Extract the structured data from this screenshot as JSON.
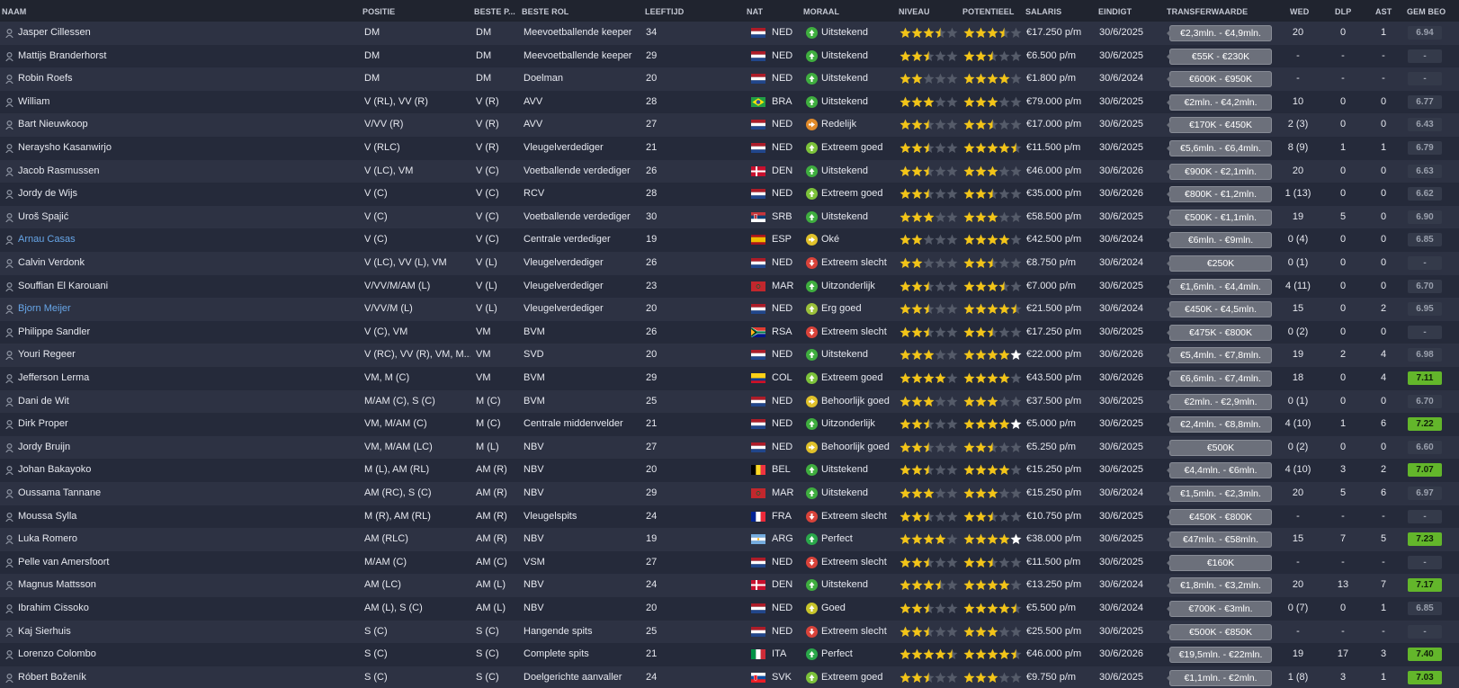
{
  "columns": {
    "naam": "NAAM",
    "positie": "POSITIE",
    "beste_p": "BESTE P...",
    "beste_rol": "BESTE ROL",
    "leeftijd": "LEEFTIJD",
    "nat": "NAT",
    "moraal": "MORAAL",
    "niveau": "NIVEAU",
    "potentieel": "POTENTIEEL",
    "salaris": "SALARIS",
    "eindigt": "EINDIGT",
    "transferwaarde": "TRANSFERWAARDE",
    "wed": "WED",
    "dlp": "DLP",
    "ast": "AST",
    "gem_beo": "GEM BEO"
  },
  "colors": {
    "header_bg": "#20242f",
    "row_odd": "#2d3243",
    "row_even": "#252a3a",
    "link": "#67a6e8",
    "star": "#f2c418",
    "rating_green": "#63b62b"
  },
  "players": [
    {
      "name": "Jasper Cillessen",
      "link": false,
      "pos": "DM",
      "best_pos": "DM",
      "role": "Meevoetballende keeper",
      "age": "34",
      "flag": "ned",
      "nat": "NED",
      "morale": "Uitstekend",
      "mor_type": "up",
      "mor_color": "#3fae3f",
      "niveau": 3.5,
      "potentieel": 3.5,
      "pot_white": false,
      "salary": "€17.250 p/m",
      "ends": "30/6/2025",
      "value": "€2,3mln. - €4,9mln.",
      "wed": "20",
      "dlp": "0",
      "ast": "1",
      "rating": "6.94",
      "rating_green": false
    },
    {
      "name": "Mattijs Branderhorst",
      "link": false,
      "pos": "DM",
      "best_pos": "DM",
      "role": "Meevoetballende keeper",
      "age": "29",
      "flag": "ned",
      "nat": "NED",
      "morale": "Uitstekend",
      "mor_type": "up",
      "mor_color": "#3fae3f",
      "niveau": 2.5,
      "potentieel": 2.5,
      "pot_white": false,
      "salary": "€6.500 p/m",
      "ends": "30/6/2025",
      "value": "€55K - €230K",
      "wed": "-",
      "dlp": "-",
      "ast": "-",
      "rating": "-",
      "rating_green": false
    },
    {
      "name": "Robin Roefs",
      "link": false,
      "pos": "DM",
      "best_pos": "DM",
      "role": "Doelman",
      "age": "20",
      "flag": "ned",
      "nat": "NED",
      "morale": "Uitstekend",
      "mor_type": "up",
      "mor_color": "#3fae3f",
      "niveau": 2,
      "potentieel": 4,
      "pot_white": true,
      "salary": "€1.800 p/m",
      "ends": "30/6/2024",
      "value": "€600K - €950K",
      "wed": "-",
      "dlp": "-",
      "ast": "-",
      "rating": "-",
      "rating_green": false
    },
    {
      "name": "William",
      "link": false,
      "pos": "V (RL), VV (R)",
      "best_pos": "V (R)",
      "role": "AVV",
      "age": "28",
      "flag": "bra",
      "nat": "BRA",
      "morale": "Uitstekend",
      "mor_type": "up",
      "mor_color": "#3fae3f",
      "niveau": 3,
      "potentieel": 3,
      "pot_white": false,
      "salary": "€79.000 p/m",
      "ends": "30/6/2025",
      "value": "€2mln. - €4,2mln.",
      "wed": "10",
      "dlp": "0",
      "ast": "0",
      "rating": "6.77",
      "rating_green": false
    },
    {
      "name": "Bart Nieuwkoop",
      "link": false,
      "pos": "V/VV (R)",
      "best_pos": "V (R)",
      "role": "AVV",
      "age": "27",
      "flag": "ned",
      "nat": "NED",
      "morale": "Redelijk",
      "mor_type": "right",
      "mor_color": "#e08a2a",
      "niveau": 2.5,
      "potentieel": 2.5,
      "pot_white": false,
      "salary": "€17.000 p/m",
      "ends": "30/6/2025",
      "value": "€170K - €450K",
      "wed": "2 (3)",
      "dlp": "0",
      "ast": "0",
      "rating": "6.43",
      "rating_green": false
    },
    {
      "name": "Neraysho Kasanwirjo",
      "link": false,
      "pos": "V (RLC)",
      "best_pos": "V (R)",
      "role": "Vleugelverdediger",
      "age": "21",
      "flag": "ned",
      "nat": "NED",
      "morale": "Extreem goed",
      "mor_type": "up",
      "mor_color": "#7cc23a",
      "niveau": 2.5,
      "potentieel": 4.5,
      "pot_white": false,
      "salary": "€11.500 p/m",
      "ends": "30/6/2025",
      "value": "€5,6mln. - €6,4mln.",
      "wed": "8 (9)",
      "dlp": "1",
      "ast": "1",
      "rating": "6.79",
      "rating_green": false
    },
    {
      "name": "Jacob Rasmussen",
      "link": false,
      "pos": "V (LC), VM",
      "best_pos": "V (C)",
      "role": "Voetballende verdediger",
      "age": "26",
      "flag": "den",
      "nat": "DEN",
      "morale": "Uitstekend",
      "mor_type": "up",
      "mor_color": "#3fae3f",
      "niveau": 2.5,
      "potentieel": 3,
      "pot_white": false,
      "salary": "€46.000 p/m",
      "ends": "30/6/2026",
      "value": "€900K - €2,1mln.",
      "wed": "20",
      "dlp": "0",
      "ast": "0",
      "rating": "6.63",
      "rating_green": false
    },
    {
      "name": "Jordy de Wijs",
      "link": false,
      "pos": "V (C)",
      "best_pos": "V (C)",
      "role": "RCV",
      "age": "28",
      "flag": "ned",
      "nat": "NED",
      "morale": "Extreem goed",
      "mor_type": "up",
      "mor_color": "#7cc23a",
      "niveau": 2.5,
      "potentieel": 2.5,
      "pot_white": false,
      "salary": "€35.000 p/m",
      "ends": "30/6/2026",
      "value": "€800K - €1,2mln.",
      "wed": "1 (13)",
      "dlp": "0",
      "ast": "0",
      "rating": "6.62",
      "rating_green": false
    },
    {
      "name": "Uroš Spajić",
      "link": false,
      "pos": "V (C)",
      "best_pos": "V (C)",
      "role": "Voetballende verdediger",
      "age": "30",
      "flag": "srb",
      "nat": "SRB",
      "morale": "Uitstekend",
      "mor_type": "up",
      "mor_color": "#3fae3f",
      "niveau": 3,
      "potentieel": 3,
      "pot_white": false,
      "salary": "€58.500 p/m",
      "ends": "30/6/2025",
      "value": "€500K - €1,1mln.",
      "wed": "19",
      "dlp": "5",
      "ast": "0",
      "rating": "6.90",
      "rating_green": false
    },
    {
      "name": "Arnau Casas",
      "link": true,
      "pos": "V (C)",
      "best_pos": "V (C)",
      "role": "Centrale verdediger",
      "age": "19",
      "flag": "esp",
      "nat": "ESP",
      "morale": "Oké",
      "mor_type": "right",
      "mor_color": "#e0c12a",
      "niveau": 2,
      "potentieel": 4,
      "pot_white": true,
      "salary": "€42.500 p/m",
      "ends": "30/6/2024",
      "value": "€6mln. - €9mln.",
      "wed": "0 (4)",
      "dlp": "0",
      "ast": "0",
      "rating": "6.85",
      "rating_green": false
    },
    {
      "name": "Calvin Verdonk",
      "link": false,
      "pos": "V (LC), VV (L), VM",
      "best_pos": "V (L)",
      "role": "Vleugelverdediger",
      "age": "26",
      "flag": "ned",
      "nat": "NED",
      "morale": "Extreem slecht",
      "mor_type": "down",
      "mor_color": "#d9433a",
      "niveau": 2,
      "potentieel": 2.5,
      "pot_white": false,
      "salary": "€8.750 p/m",
      "ends": "30/6/2024",
      "value": "€250K",
      "wed": "0 (1)",
      "dlp": "0",
      "ast": "0",
      "rating": "-",
      "rating_green": false
    },
    {
      "name": "Souffian El Karouani",
      "link": false,
      "pos": "V/VV/M/AM (L)",
      "best_pos": "V (L)",
      "role": "Vleugelverdediger",
      "age": "23",
      "flag": "mar",
      "nat": "MAR",
      "morale": "Uitzonderlijk",
      "mor_type": "up",
      "mor_color": "#3fae3f",
      "niveau": 2.5,
      "potentieel": 3.5,
      "pot_white": false,
      "salary": "€7.000 p/m",
      "ends": "30/6/2025",
      "value": "€1,6mln. - €4,4mln.",
      "wed": "4 (11)",
      "dlp": "0",
      "ast": "0",
      "rating": "6.70",
      "rating_green": false
    },
    {
      "name": "Bjorn Meijer",
      "link": true,
      "pos": "V/VV/M (L)",
      "best_pos": "V (L)",
      "role": "Vleugelverdediger",
      "age": "20",
      "flag": "ned",
      "nat": "NED",
      "morale": "Erg goed",
      "mor_type": "up",
      "mor_color": "#9bc13a",
      "niveau": 2.5,
      "potentieel": 4.5,
      "pot_white": false,
      "salary": "€21.500 p/m",
      "ends": "30/6/2024",
      "value": "€450K - €4,5mln.",
      "wed": "15",
      "dlp": "0",
      "ast": "2",
      "rating": "6.95",
      "rating_green": false
    },
    {
      "name": "Philippe Sandler",
      "link": false,
      "pos": "V (C), VM",
      "best_pos": "VM",
      "role": "BVM",
      "age": "26",
      "flag": "rsa",
      "nat": "RSA",
      "morale": "Extreem slecht",
      "mor_type": "down",
      "mor_color": "#d9433a",
      "niveau": 2.5,
      "potentieel": 2.5,
      "pot_white": false,
      "salary": "€17.250 p/m",
      "ends": "30/6/2025",
      "value": "€475K - €800K",
      "wed": "0 (2)",
      "dlp": "0",
      "ast": "0",
      "rating": "-",
      "rating_green": false
    },
    {
      "name": "Youri Regeer",
      "link": false,
      "pos": "V (RC), VV (R), VM, M...",
      "best_pos": "VM",
      "role": "SVD",
      "age": "20",
      "flag": "ned",
      "nat": "NED",
      "morale": "Uitstekend",
      "mor_type": "up",
      "mor_color": "#3fae3f",
      "niveau": 3,
      "potentieel": 5,
      "pot_white": true,
      "salary": "€22.000 p/m",
      "ends": "30/6/2026",
      "value": "€5,4mln. - €7,8mln.",
      "wed": "19",
      "dlp": "2",
      "ast": "4",
      "rating": "6.98",
      "rating_green": false
    },
    {
      "name": "Jefferson Lerma",
      "link": false,
      "pos": "VM, M (C)",
      "best_pos": "VM",
      "role": "BVM",
      "age": "29",
      "flag": "col",
      "nat": "COL",
      "morale": "Extreem goed",
      "mor_type": "up",
      "mor_color": "#7cc23a",
      "niveau": 4,
      "potentieel": 4,
      "pot_white": false,
      "salary": "€43.500 p/m",
      "ends": "30/6/2026",
      "value": "€6,6mln. - €7,4mln.",
      "wed": "18",
      "dlp": "0",
      "ast": "4",
      "rating": "7.11",
      "rating_green": true
    },
    {
      "name": "Dani de Wit",
      "link": false,
      "pos": "M/AM (C), S (C)",
      "best_pos": "M (C)",
      "role": "BVM",
      "age": "25",
      "flag": "ned",
      "nat": "NED",
      "morale": "Behoorlijk goed",
      "mor_type": "right",
      "mor_color": "#e0c12a",
      "niveau": 3,
      "potentieel": 3,
      "pot_white": false,
      "salary": "€37.500 p/m",
      "ends": "30/6/2025",
      "value": "€2mln. - €2,9mln.",
      "wed": "0 (1)",
      "dlp": "0",
      "ast": "0",
      "rating": "6.70",
      "rating_green": false
    },
    {
      "name": "Dirk Proper",
      "link": false,
      "pos": "VM, M/AM (C)",
      "best_pos": "M (C)",
      "role": "Centrale middenvelder",
      "age": "21",
      "flag": "ned",
      "nat": "NED",
      "morale": "Uitzonderlijk",
      "mor_type": "up",
      "mor_color": "#3fae3f",
      "niveau": 2.5,
      "potentieel": 5,
      "pot_white": true,
      "salary": "€5.000 p/m",
      "ends": "30/6/2025",
      "value": "€2,4mln. - €8,8mln.",
      "wed": "4 (10)",
      "dlp": "1",
      "ast": "6",
      "rating": "7.22",
      "rating_green": true
    },
    {
      "name": "Jordy Bruijn",
      "link": false,
      "pos": "VM, M/AM (LC)",
      "best_pos": "M (L)",
      "role": "NBV",
      "age": "27",
      "flag": "ned",
      "nat": "NED",
      "morale": "Behoorlijk goed",
      "mor_type": "right",
      "mor_color": "#e0c12a",
      "niveau": 2.5,
      "potentieel": 2.5,
      "pot_white": false,
      "salary": "€5.250 p/m",
      "ends": "30/6/2025",
      "value": "€500K",
      "wed": "0 (2)",
      "dlp": "0",
      "ast": "0",
      "rating": "6.60",
      "rating_green": false
    },
    {
      "name": "Johan Bakayoko",
      "link": false,
      "pos": "M (L), AM (RL)",
      "best_pos": "AM (R)",
      "role": "NBV",
      "age": "20",
      "flag": "bel",
      "nat": "BEL",
      "morale": "Uitstekend",
      "mor_type": "up",
      "mor_color": "#3fae3f",
      "niveau": 2.5,
      "potentieel": 4,
      "pot_white": true,
      "salary": "€15.250 p/m",
      "ends": "30/6/2025",
      "value": "€4,4mln. - €6mln.",
      "wed": "4 (10)",
      "dlp": "3",
      "ast": "2",
      "rating": "7.07",
      "rating_green": true
    },
    {
      "name": "Oussama Tannane",
      "link": false,
      "pos": "AM (RC), S (C)",
      "best_pos": "AM (R)",
      "role": "NBV",
      "age": "29",
      "flag": "mar",
      "nat": "MAR",
      "morale": "Uitstekend",
      "mor_type": "up",
      "mor_color": "#3fae3f",
      "niveau": 3,
      "potentieel": 3,
      "pot_white": false,
      "salary": "€15.250 p/m",
      "ends": "30/6/2024",
      "value": "€1,5mln. - €2,3mln.",
      "wed": "20",
      "dlp": "5",
      "ast": "6",
      "rating": "6.97",
      "rating_green": false
    },
    {
      "name": "Moussa Sylla",
      "link": false,
      "pos": "M (R), AM (RL)",
      "best_pos": "AM (R)",
      "role": "Vleugelspits",
      "age": "24",
      "flag": "fra",
      "nat": "FRA",
      "morale": "Extreem slecht",
      "mor_type": "down",
      "mor_color": "#d9433a",
      "niveau": 2.5,
      "potentieel": 2.5,
      "pot_white": false,
      "salary": "€10.750 p/m",
      "ends": "30/6/2025",
      "value": "€450K - €800K",
      "wed": "-",
      "dlp": "-",
      "ast": "-",
      "rating": "-",
      "rating_green": false
    },
    {
      "name": "Luka Romero",
      "link": false,
      "pos": "AM (RLC)",
      "best_pos": "AM (R)",
      "role": "NBV",
      "age": "19",
      "flag": "arg",
      "nat": "ARG",
      "morale": "Perfect",
      "mor_type": "up",
      "mor_color": "#2aa84a",
      "niveau": 4,
      "potentieel": 5,
      "pot_white": true,
      "salary": "€38.000 p/m",
      "ends": "30/6/2025",
      "value": "€47mln. - €58mln.",
      "wed": "15",
      "dlp": "7",
      "ast": "5",
      "rating": "7.23",
      "rating_green": true
    },
    {
      "name": "Pelle van Amersfoort",
      "link": false,
      "pos": "M/AM (C)",
      "best_pos": "AM (C)",
      "role": "VSM",
      "age": "27",
      "flag": "ned",
      "nat": "NED",
      "morale": "Extreem slecht",
      "mor_type": "down",
      "mor_color": "#d9433a",
      "niveau": 2.5,
      "potentieel": 2.5,
      "pot_white": false,
      "salary": "€11.500 p/m",
      "ends": "30/6/2025",
      "value": "€160K",
      "wed": "-",
      "dlp": "-",
      "ast": "-",
      "rating": "-",
      "rating_green": false
    },
    {
      "name": "Magnus Mattsson",
      "link": false,
      "pos": "AM (LC)",
      "best_pos": "AM (L)",
      "role": "NBV",
      "age": "24",
      "flag": "den",
      "nat": "DEN",
      "morale": "Uitstekend",
      "mor_type": "up",
      "mor_color": "#3fae3f",
      "niveau": 3.5,
      "potentieel": 4,
      "pot_white": false,
      "salary": "€13.250 p/m",
      "ends": "30/6/2024",
      "value": "€1,8mln. - €3,2mln.",
      "wed": "20",
      "dlp": "13",
      "ast": "7",
      "rating": "7.17",
      "rating_green": true
    },
    {
      "name": "Ibrahim Cissoko",
      "link": false,
      "pos": "AM (L), S (C)",
      "best_pos": "AM (L)",
      "role": "NBV",
      "age": "20",
      "flag": "ned",
      "nat": "NED",
      "morale": "Goed",
      "mor_type": "up",
      "mor_color": "#c7c42a",
      "niveau": 2.5,
      "potentieel": 4.5,
      "pot_white": false,
      "salary": "€5.500 p/m",
      "ends": "30/6/2024",
      "value": "€700K - €3mln.",
      "wed": "0 (7)",
      "dlp": "0",
      "ast": "1",
      "rating": "6.85",
      "rating_green": false
    },
    {
      "name": "Kaj Sierhuis",
      "link": false,
      "pos": "S (C)",
      "best_pos": "S (C)",
      "role": "Hangende spits",
      "age": "25",
      "flag": "ned",
      "nat": "NED",
      "morale": "Extreem slecht",
      "mor_type": "down",
      "mor_color": "#d9433a",
      "niveau": 2.5,
      "potentieel": 3,
      "pot_white": false,
      "salary": "€25.500 p/m",
      "ends": "30/6/2025",
      "value": "€500K - €850K",
      "wed": "-",
      "dlp": "-",
      "ast": "-",
      "rating": "-",
      "rating_green": false
    },
    {
      "name": "Lorenzo Colombo",
      "link": false,
      "pos": "S (C)",
      "best_pos": "S (C)",
      "role": "Complete spits",
      "age": "21",
      "flag": "ita",
      "nat": "ITA",
      "morale": "Perfect",
      "mor_type": "up",
      "mor_color": "#2aa84a",
      "niveau": 4.5,
      "potentieel": 4.5,
      "pot_white": false,
      "salary": "€46.000 p/m",
      "ends": "30/6/2026",
      "value": "€19,5mln. - €22mln.",
      "wed": "19",
      "dlp": "17",
      "ast": "3",
      "rating": "7.40",
      "rating_green": true
    },
    {
      "name": "Róbert Boženík",
      "link": false,
      "pos": "S (C)",
      "best_pos": "S (C)",
      "role": "Doelgerichte aanvaller",
      "age": "24",
      "flag": "svk",
      "nat": "SVK",
      "morale": "Extreem goed",
      "mor_type": "up",
      "mor_color": "#7cc23a",
      "niveau": 2.5,
      "potentieel": 3,
      "pot_white": false,
      "salary": "€9.750 p/m",
      "ends": "30/6/2025",
      "value": "€1,1mln. - €2mln.",
      "wed": "1 (8)",
      "dlp": "3",
      "ast": "1",
      "rating": "7.03",
      "rating_green": true
    }
  ]
}
